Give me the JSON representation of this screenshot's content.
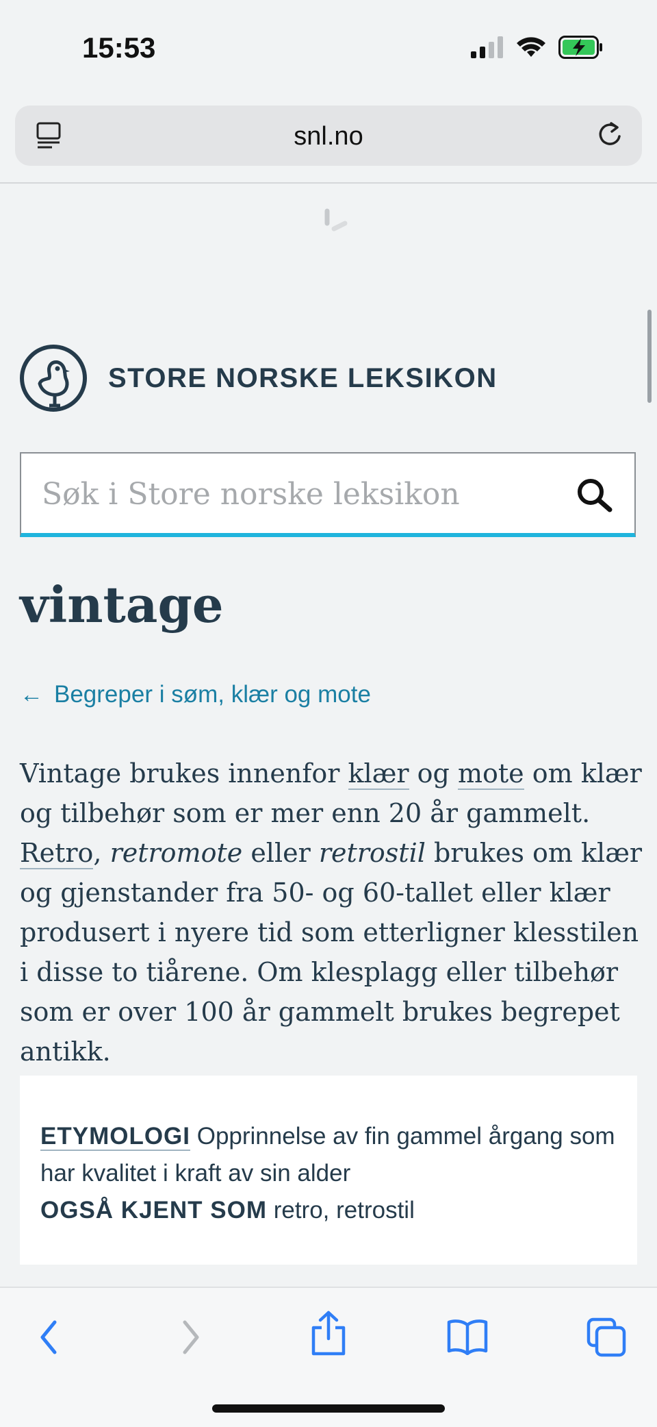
{
  "status_bar": {
    "time": "15:53"
  },
  "browser": {
    "url": "snl.no"
  },
  "site": {
    "name": "STORE NORSKE LEKSIKON"
  },
  "search": {
    "placeholder": "Søk i Store norske leksikon"
  },
  "article": {
    "title": "vintage",
    "breadcrumb_arrow": "←",
    "breadcrumb": "Begreper i søm, klær og mote",
    "body": {
      "p1": "Vintage brukes innenfor ",
      "link_klaer": "klær",
      "p2": " og ",
      "link_mote": "mote",
      "p3": " om klær og tilbehør som er mer enn 20 år gammelt. ",
      "link_retro": "Retro",
      "p4": ", ",
      "em1": "retromote",
      "p5": " eller ",
      "em2": "retrostil",
      "p6": " brukes om klær og gjenstander fra 50- og 60-tallet eller klær produsert i nyere tid som etterligner klesstilen i disse to tiårene. Om klesplagg eller tilbehør som er over 100 år gammelt brukes begrepet antikk."
    },
    "facts": {
      "etymology_label": "ETYMOLOGI",
      "etymology_value": " Opprinnelse av fin gammel årgang som har kvalitet i kraft av sin alder",
      "aka_label": "OGSÅ KJENT SOM",
      "aka_value": " retro, retrostil"
    }
  },
  "colors": {
    "accent": "#1fb4dd",
    "link": "#1a7fa3",
    "text": "#253b4b",
    "ios_blue": "#2f7ef6"
  }
}
